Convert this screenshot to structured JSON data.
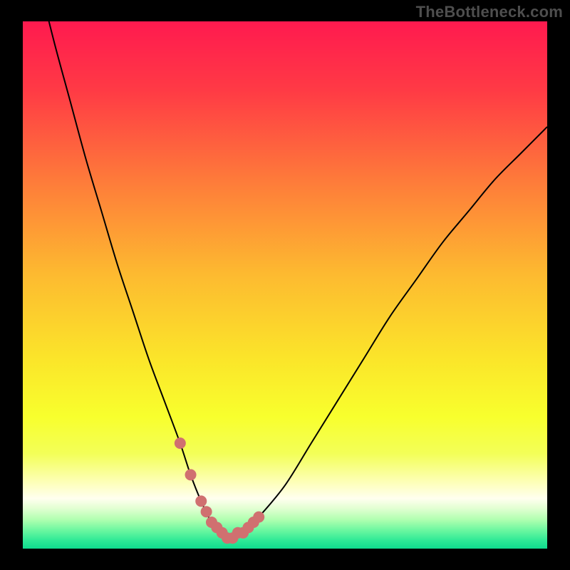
{
  "watermark": {
    "text": "TheBottleneck.com"
  },
  "chart_data": {
    "type": "line",
    "title": "",
    "xlabel": "",
    "ylabel": "",
    "xlim": [
      0,
      100
    ],
    "ylim": [
      0,
      100
    ],
    "x": [
      0,
      3,
      6,
      9,
      12,
      15,
      18,
      21,
      24,
      27,
      30,
      32,
      34,
      36,
      38,
      40,
      42,
      45,
      50,
      55,
      60,
      65,
      70,
      75,
      80,
      85,
      90,
      95,
      100
    ],
    "values": [
      120,
      108,
      96,
      85,
      74,
      64,
      54,
      45,
      36,
      28,
      20,
      14,
      9,
      5,
      3,
      2,
      3,
      6,
      12,
      20,
      28,
      36,
      44,
      51,
      58,
      64,
      70,
      75,
      80
    ],
    "series": [
      {
        "name": "bottleneck-curve",
        "color": "#000000",
        "x": [
          0,
          3,
          6,
          9,
          12,
          15,
          18,
          21,
          24,
          27,
          30,
          32,
          34,
          36,
          38,
          40,
          42,
          45,
          50,
          55,
          60,
          65,
          70,
          75,
          80,
          85,
          90,
          95,
          100
        ],
        "values": [
          120,
          108,
          96,
          85,
          74,
          64,
          54,
          45,
          36,
          28,
          20,
          14,
          9,
          5,
          3,
          2,
          3,
          6,
          12,
          20,
          28,
          36,
          44,
          51,
          58,
          64,
          70,
          75,
          80
        ]
      }
    ],
    "markers": {
      "color": "#d07070",
      "radius_px": 8,
      "x": [
        30,
        32,
        34,
        35,
        36,
        37,
        38,
        39,
        40,
        41,
        42,
        43,
        44,
        45
      ],
      "values": [
        20,
        14,
        9,
        7,
        5,
        4,
        3,
        2,
        2,
        3,
        3,
        4,
        5,
        6
      ]
    },
    "gradient_stops": [
      {
        "offset": 0.0,
        "color": "#ff1a4f"
      },
      {
        "offset": 0.13,
        "color": "#ff3a45"
      },
      {
        "offset": 0.3,
        "color": "#fe7a3a"
      },
      {
        "offset": 0.48,
        "color": "#fdba30"
      },
      {
        "offset": 0.64,
        "color": "#fbe52a"
      },
      {
        "offset": 0.75,
        "color": "#f8ff2d"
      },
      {
        "offset": 0.82,
        "color": "#f3ff58"
      },
      {
        "offset": 0.873,
        "color": "#fdffb6"
      },
      {
        "offset": 0.905,
        "color": "#ffffef"
      },
      {
        "offset": 0.923,
        "color": "#e3ffd3"
      },
      {
        "offset": 0.945,
        "color": "#b0ffb0"
      },
      {
        "offset": 0.965,
        "color": "#6cf7a0"
      },
      {
        "offset": 0.985,
        "color": "#2de996"
      },
      {
        "offset": 1.0,
        "color": "#0fdc8e"
      }
    ]
  }
}
